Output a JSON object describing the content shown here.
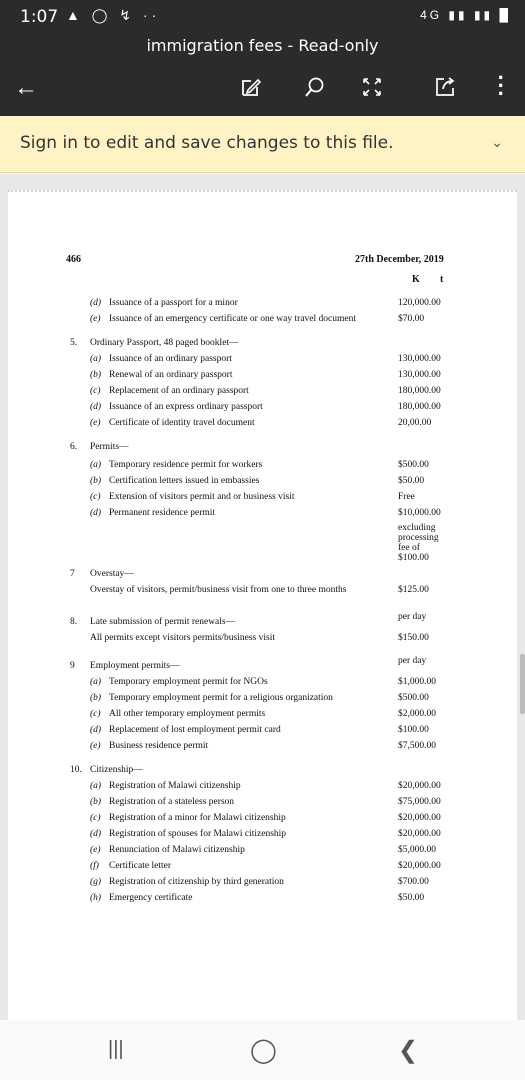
{
  "status": {
    "time": "1:07",
    "network": "4G"
  },
  "app": {
    "title": "immigration fees - Read-only"
  },
  "banner": {
    "message": "Sign in to edit and save changes to this file."
  },
  "doc": {
    "page_number": "466",
    "date": "27th December, 2019",
    "col_k": "K",
    "col_t": "t",
    "rows": [
      {
        "num": "",
        "sub": "(d)",
        "text": "Issuance of a passport for a minor",
        "amount": "120,000.00"
      },
      {
        "num": "",
        "sub": "(e)",
        "text": "Issuance of an emergency certificate or one way travel document",
        "amount": "$70.00"
      },
      {
        "num": "5.",
        "sub": "",
        "text": "Ordinary Passport, 48 paged booklet—",
        "amount": ""
      },
      {
        "num": "",
        "sub": "(a)",
        "text": "Issuance of an ordinary passport",
        "amount": "130,000.00"
      },
      {
        "num": "",
        "sub": "(b)",
        "text": "Renewal of an ordinary passport",
        "amount": "130,000.00"
      },
      {
        "num": "",
        "sub": "(c)",
        "text": "Replacement of an ordinary passport",
        "amount": "180,000.00"
      },
      {
        "num": "",
        "sub": "(d)",
        "text": "Issuance of an express ordinary passport",
        "amount": "180,000.00"
      },
      {
        "num": "",
        "sub": "(e)",
        "text": "Certificate of identity travel document",
        "amount": "20,00.00"
      },
      {
        "num": "6.",
        "sub": "",
        "text": "Permits—",
        "amount": ""
      },
      {
        "num": "",
        "sub": "(a)",
        "text": "Temporary residence permit for workers",
        "amount": "$500.00"
      },
      {
        "num": "",
        "sub": "(b)",
        "text": "Certification letters issued in embassies",
        "amount": "$50.00"
      },
      {
        "num": "",
        "sub": "(c)",
        "text": "Extension of visitors permit and or business visit",
        "amount": "Free"
      },
      {
        "num": "",
        "sub": "(d)",
        "text": "Permanent residence permit",
        "amount": "$10,000.00"
      },
      {
        "num": "7",
        "sub": "",
        "text": "Overstay—",
        "amount": ""
      },
      {
        "num": "",
        "sub": "",
        "text": "Overstay of visitors, permit/business visit from one to three months",
        "amount": "$125.00"
      },
      {
        "num": "8.",
        "sub": "",
        "text": "Late submission of permit renewals—",
        "amount": ""
      },
      {
        "num": "",
        "sub": "",
        "text": "All permits except visitors permits/business visit",
        "amount": "$150.00"
      },
      {
        "num": "9",
        "sub": "",
        "text": "Employment permits—",
        "amount": ""
      },
      {
        "num": "",
        "sub": "(a)",
        "text": "Temporary employment permit for NGOs",
        "amount": "$1,000.00"
      },
      {
        "num": "",
        "sub": "(b)",
        "text": "Temporary employment permit for a religious organization",
        "amount": "$500.00"
      },
      {
        "num": "",
        "sub": "(c)",
        "text": "All other temporary employment permits",
        "amount": "$2,000.00"
      },
      {
        "num": "",
        "sub": "(d)",
        "text": "Replacement of lost employment permit card",
        "amount": "$100.00"
      },
      {
        "num": "",
        "sub": "(e)",
        "text": "Business residence permit",
        "amount": "$7,500.00"
      },
      {
        "num": "10.",
        "sub": "",
        "text": "Citizenship—",
        "amount": ""
      },
      {
        "num": "",
        "sub": "(a)",
        "text": "Registration of Malawi citizenship",
        "amount": "$20,000.00"
      },
      {
        "num": "",
        "sub": "(b)",
        "text": "Registration of a stateless person",
        "amount": "$75,000.00"
      },
      {
        "num": "",
        "sub": "(c)",
        "text": "Registration of a minor for Malawi citizenship",
        "amount": "$20,000.00"
      },
      {
        "num": "",
        "sub": "(d)",
        "text": "Registration of spouses for Malawi citizenship",
        "amount": "$20,000.00"
      },
      {
        "num": "",
        "sub": "(e)",
        "text": "Renunciation of Malawi citizenship",
        "amount": "$5,000.00"
      },
      {
        "num": "",
        "sub": "(f)",
        "text": "Certificate letter",
        "amount": "$20,000.00"
      },
      {
        "num": "",
        "sub": "(g)",
        "text": "Registration of citizenship by third generation",
        "amount": "$700.00"
      },
      {
        "num": "",
        "sub": "(h)",
        "text": "Emergency certificate",
        "amount": "$50.00"
      }
    ],
    "permanent_residence_extra": [
      "excluding",
      "processing",
      "fee of",
      "$100.00"
    ],
    "per_day_1": "per day",
    "per_day_2": "per day"
  },
  "icons": {
    "back": "back-arrow-icon",
    "edit": "edit-pen-icon",
    "search": "search-icon",
    "fullscreen": "fullscreen-icon",
    "share": "share-icon",
    "more": "more-vertical-icon",
    "chevron": "chevron-down-icon"
  }
}
